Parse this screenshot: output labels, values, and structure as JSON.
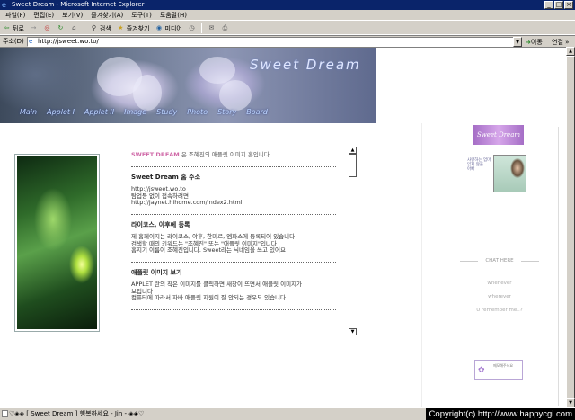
{
  "window": {
    "title": "Sweet Dream - Microsoft Internet Explorer",
    "controls": [
      "_",
      "□",
      "×"
    ]
  },
  "menu": [
    "파일(F)",
    "편집(E)",
    "보기(V)",
    "즐겨찾기(A)",
    "도구(T)",
    "도움말(H)"
  ],
  "toolbar": {
    "back": "뒤로",
    "forward": "→",
    "stop": "◎",
    "refresh": "↻",
    "home": "⌂",
    "search": "검색",
    "favorites": "즐겨찾기",
    "media": "미디어",
    "history": "◷",
    "mail": "✉",
    "print": "⎙"
  },
  "address": {
    "label": "주소(D)",
    "url": "http://jsweet.wo.to/",
    "go": "이동",
    "links": "연결 »"
  },
  "banner": {
    "title": "Sweet Dream",
    "nav": [
      "Main",
      "Applet I",
      "Applet II",
      "Image",
      "Study",
      "Photo",
      "Story",
      "Board"
    ]
  },
  "content": {
    "intro_brand": "SWEET DREAM",
    "intro_text": " 은 조혜진의 애플릿 이미지 홈입니다",
    "sections": [
      {
        "title": "Sweet Dream 홈 주소",
        "lines": [
          "http://jsweet.wo.to",
          "탐업등 없이 접속하려면",
          "http://jaynet.hihome.com/index2.html"
        ]
      },
      {
        "title": "라이코스, 야후에 등록",
        "lines": [
          "제 홈페이지는 라이코스, 야후, 한미르, 엠파스에 등록되어 있습니다",
          "검색할 때의 키워드는 \"조혜진\" 또는 \"애플릿 이미지\"입니다",
          "홈지기 이름이 조혜진입니다. Sweet라는 닉네임을 쓰고 있어요"
        ]
      },
      {
        "title": "애플릿 이미지 보기",
        "lines": [
          "APPLET 란의 작은 이미지를 클릭하면 새창이 뜨면서 애플릿 이미지가",
          "보입니다",
          "컴퓨터에 따라서 자바 애플릿 지원이 잘 안되는 경우도 있습니다"
        ]
      }
    ]
  },
  "right": {
    "logo": "Sweet Dream",
    "photo_text": [
      "사랑하는 엄마",
      "잊지 않을",
      "아빠"
    ],
    "chat_label": "CHAT HERE",
    "whispers": [
      "whenever",
      "wherever",
      "U remember me..?"
    ],
    "widget_text": "메모해주세요"
  },
  "status": {
    "text": "♡◈◈ [ Sweet Dream ] 행복하세요 - Jin - ◈◈♡",
    "copyright": "Copyright(c) http://www.happycgi.com"
  },
  "colors": {
    "title_bar": "#0a246a",
    "brand_pink": "#d06aa8",
    "accent_purple": "#a56ec6"
  }
}
